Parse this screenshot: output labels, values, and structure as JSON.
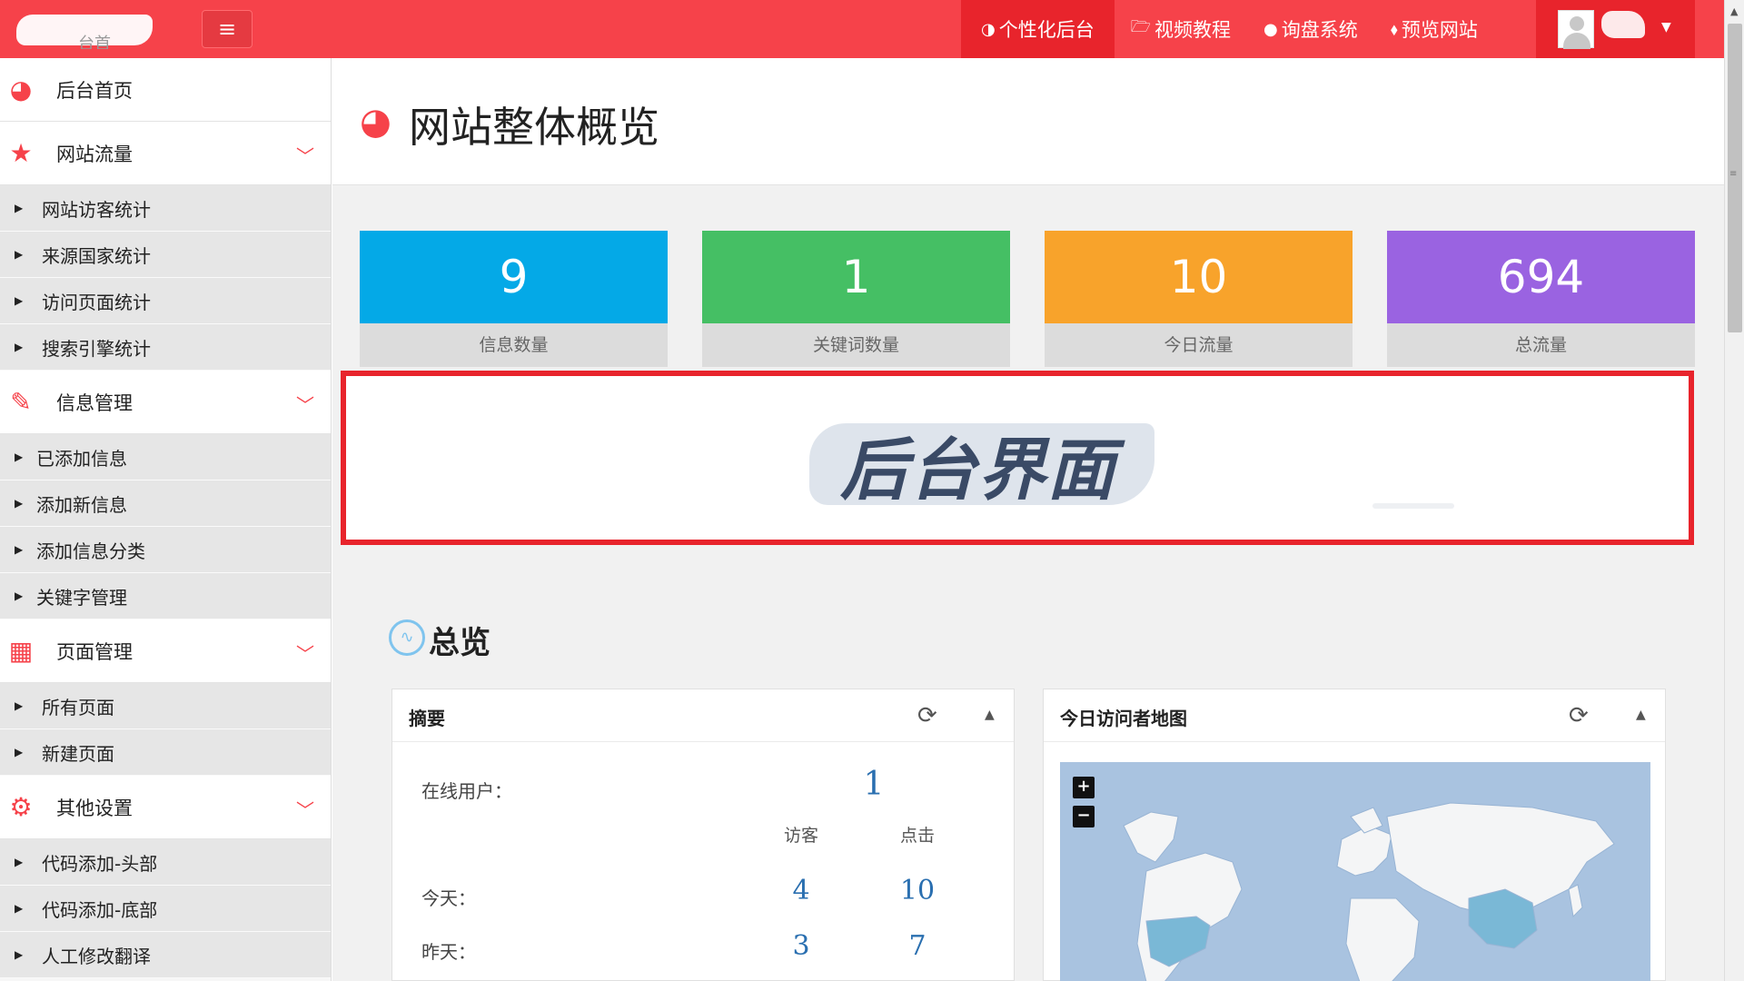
{
  "header": {
    "logo_text": "台首",
    "nav": [
      {
        "icon": "◑",
        "label": "个性化后台"
      },
      {
        "icon": "🗁",
        "label": "视频教程"
      },
      {
        "icon": "●",
        "label": "询盘系统"
      },
      {
        "icon": "⬧",
        "label": "预览网站"
      }
    ]
  },
  "sidebar": {
    "home": "后台首页",
    "groups": [
      {
        "label": "网站流量",
        "items": [
          "网站访客统计",
          "来源国家统计",
          "访问页面统计",
          "搜索引擎统计"
        ]
      },
      {
        "label": "信息管理",
        "items": [
          "已添加信息",
          "添加新信息",
          "添加信息分类",
          "关键字管理"
        ]
      },
      {
        "label": "页面管理",
        "items": [
          "所有页面",
          "新建页面"
        ]
      },
      {
        "label": "其他设置",
        "items": [
          "代码添加-头部",
          "代码添加-底部",
          "人工修改翻译"
        ]
      }
    ]
  },
  "main": {
    "title": "网站整体概览",
    "stats": [
      {
        "value": "9",
        "label": "信息数量",
        "color": "#04a9e7"
      },
      {
        "value": "1",
        "label": "关键词数量",
        "color": "#45bf64"
      },
      {
        "value": "10",
        "label": "今日流量",
        "color": "#f8a32b"
      },
      {
        "value": "694",
        "label": "总流量",
        "color": "#9a63e1"
      }
    ],
    "banner_text": "后台界面",
    "section_title": "总览",
    "summary": {
      "title": "摘要",
      "online_label": "在线用户：",
      "online_value": "1",
      "col_visitors": "访客",
      "col_clicks": "点击",
      "today_label": "今天：",
      "today_visitors": "4",
      "today_clicks": "10",
      "yesterday_label": "昨天：",
      "yesterday_visitors": "3",
      "yesterday_clicks": "7"
    },
    "map_panel": {
      "title": "今日访问者地图",
      "zoom_in": "+",
      "zoom_out": "−"
    }
  },
  "colors": {
    "brand_red": "#f6424a",
    "active_red": "#e8242c",
    "value_blue": "#2a6fb0"
  }
}
